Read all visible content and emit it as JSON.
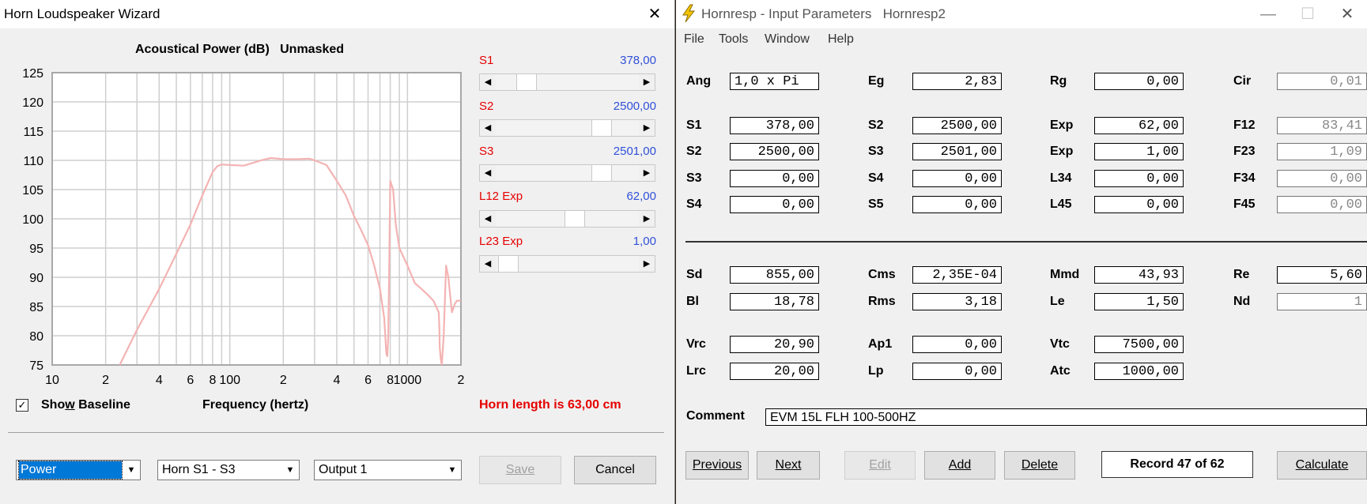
{
  "wizard": {
    "title": "Horn Loudspeaker Wizard",
    "chart_title": "Acoustical Power (dB)   Unmasked",
    "xlabel": "Frequency (hertz)",
    "horn_length": "Horn length is 63,00 cm",
    "show_baseline_pre": "Sho",
    "show_baseline_ul": "w",
    "show_baseline_post": " Baseline",
    "sliders": [
      {
        "label": "S1",
        "value": "378,00",
        "position": 0.17
      },
      {
        "label": "S2",
        "value": "2500,00",
        "position": 0.78
      },
      {
        "label": "S3",
        "value": "2501,00",
        "position": 0.78
      },
      {
        "label": "L12 Exp",
        "value": "62,00",
        "position": 0.56
      },
      {
        "label": "L23 Exp",
        "value": "1,00",
        "position": 0.02
      }
    ],
    "combo_type": "Power",
    "combo_horn": "Horn S1 - S3",
    "combo_output": "Output 1",
    "save_label": "Save",
    "cancel_label": "Cancel"
  },
  "chart_data": {
    "type": "line",
    "title": "Acoustical Power (dB)   Unmasked",
    "xlabel": "Frequency (hertz)",
    "ylabel": "",
    "x_scale": "log",
    "xlim": [
      10,
      2000
    ],
    "ylim": [
      75,
      125
    ],
    "y_ticks": [
      75,
      80,
      85,
      90,
      95,
      100,
      105,
      110,
      115,
      120,
      125
    ],
    "x_tick_labels": [
      {
        "x": 10,
        "label": "10"
      },
      {
        "x": 20,
        "label": "2"
      },
      {
        "x": 40,
        "label": "4"
      },
      {
        "x": 60,
        "label": "6"
      },
      {
        "x": 80,
        "label": "8"
      },
      {
        "x": 100,
        "label": "100"
      },
      {
        "x": 200,
        "label": "2"
      },
      {
        "x": 400,
        "label": "4"
      },
      {
        "x": 600,
        "label": "6"
      },
      {
        "x": 800,
        "label": "8"
      },
      {
        "x": 1000,
        "label": "1000"
      },
      {
        "x": 2000,
        "label": "2"
      }
    ],
    "grid": true,
    "line_color": "#f4b3b3",
    "series": [
      {
        "x": [
          24,
          30,
          40,
          50,
          60,
          70,
          80,
          85,
          90,
          100,
          120,
          150,
          170,
          200,
          240,
          280,
          300,
          350,
          400,
          450,
          500,
          550,
          600,
          650,
          700,
          740,
          760,
          770,
          780,
          790,
          800,
          830,
          860,
          900,
          1000,
          1100,
          1200,
          1300,
          1400,
          1450,
          1500,
          1510,
          1520,
          1540,
          1560,
          1600,
          1650,
          1700,
          1780,
          1850,
          1900,
          2000
        ],
        "y": [
          75,
          81,
          88,
          94,
          99,
          104,
          108,
          109,
          109.3,
          109.2,
          109.1,
          110,
          110.4,
          110.2,
          110.2,
          110.3,
          110,
          109.2,
          106.5,
          104,
          100.5,
          98,
          95.5,
          92,
          88,
          83,
          77,
          76.5,
          80,
          93,
          106.5,
          105,
          99,
          95,
          92,
          89,
          88,
          87,
          86,
          85,
          84,
          82,
          78,
          76,
          75,
          80,
          92,
          90,
          84,
          85.5,
          86,
          86
        ]
      }
    ]
  },
  "hornresp": {
    "title": "Hornresp - Input Parameters   Hornresp2",
    "menu": [
      "File",
      "Tools",
      "Window",
      "Help"
    ],
    "rows": [
      [
        {
          "l": "Ang",
          "v": "1,0 x Pi",
          "left": true
        },
        {
          "l": "Eg",
          "v": "2,83"
        },
        {
          "l": "Rg",
          "v": "0,00"
        },
        {
          "l": "Cir",
          "v": "0,01",
          "ro": true
        }
      ],
      [
        {
          "l": "S1",
          "v": "378,00"
        },
        {
          "l": "S2",
          "v": "2500,00"
        },
        {
          "l": "Exp",
          "v": "62,00"
        },
        {
          "l": "F12",
          "v": "83,41",
          "ro": true
        }
      ],
      [
        {
          "l": "S2",
          "v": "2500,00"
        },
        {
          "l": "S3",
          "v": "2501,00"
        },
        {
          "l": "Exp",
          "v": "1,00"
        },
        {
          "l": "F23",
          "v": "1,09",
          "ro": true
        }
      ],
      [
        {
          "l": "S3",
          "v": "0,00"
        },
        {
          "l": "S4",
          "v": "0,00"
        },
        {
          "l": "L34",
          "v": "0,00"
        },
        {
          "l": "F34",
          "v": "0,00",
          "ro": true
        }
      ],
      [
        {
          "l": "S4",
          "v": "0,00"
        },
        {
          "l": "S5",
          "v": "0,00"
        },
        {
          "l": "L45",
          "v": "0,00"
        },
        {
          "l": "F45",
          "v": "0,00",
          "ro": true
        }
      ],
      [
        {
          "l": "Sd",
          "v": "855,00"
        },
        {
          "l": "Cms",
          "v": "2,35E-04"
        },
        {
          "l": "Mmd",
          "v": "43,93"
        },
        {
          "l": "Re",
          "v": "5,60"
        }
      ],
      [
        {
          "l": "Bl",
          "v": "18,78"
        },
        {
          "l": "Rms",
          "v": "3,18"
        },
        {
          "l": "Le",
          "v": "1,50"
        },
        {
          "l": "Nd",
          "v": "1",
          "ro": true
        }
      ],
      [
        {
          "l": "Vrc",
          "v": "20,90"
        },
        {
          "l": "Ap1",
          "v": "0,00"
        },
        {
          "l": "Vtc",
          "v": "7500,00"
        }
      ],
      [
        {
          "l": "Lrc",
          "v": "20,00"
        },
        {
          "l": "Lp",
          "v": "0,00"
        },
        {
          "l": "Atc",
          "v": "1000,00"
        }
      ]
    ],
    "comment_label": "Comment",
    "comment": "EVM 15L FLH 100-500HZ",
    "buttons": {
      "previous": "Previous",
      "next": "Next",
      "edit": "Edit",
      "add": "Add",
      "delete": "Delete",
      "record": "Record 47 of 62",
      "calculate": "Calculate"
    }
  }
}
